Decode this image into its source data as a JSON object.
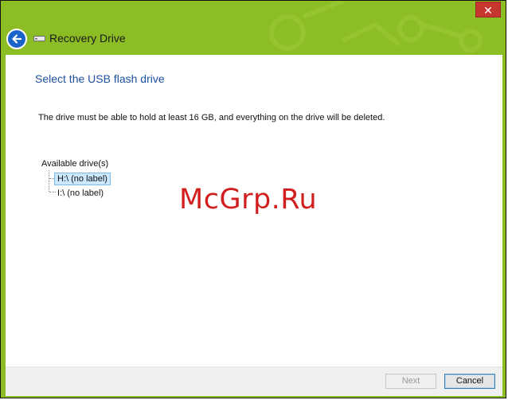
{
  "window": {
    "title": "Recovery Drive",
    "close_glyph": "✕",
    "accent_color": "#8cbd24",
    "back_button_color": "#1a63c9",
    "close_button_color": "#c7372f"
  },
  "icons": {
    "back": "back-arrow-icon",
    "drive": "drive-icon",
    "close": "close-icon"
  },
  "main": {
    "heading": "Select the USB flash drive",
    "description": "The drive must be able to hold at least 16 GB, and everything on the drive will be deleted.",
    "drives_label": "Available drive(s)",
    "drives": [
      {
        "label": "H:\\ (no label)",
        "selected": true
      },
      {
        "label": "I:\\ (no label)",
        "selected": false
      }
    ]
  },
  "watermark": "McGrp.Ru",
  "footer": {
    "next_label": "Next",
    "cancel_label": "Cancel"
  }
}
